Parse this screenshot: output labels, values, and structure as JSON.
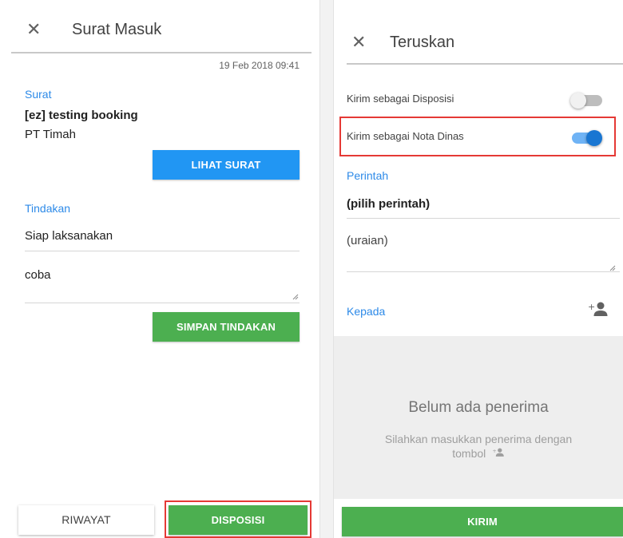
{
  "left": {
    "title": "Surat Masuk",
    "close_glyph": "✕",
    "date": "19 Feb 2018 09:41",
    "surat_label": "Surat",
    "surat_subject": "[ez] testing booking",
    "surat_org": "PT Timah",
    "lihat_button": "LIHAT SURAT",
    "tindakan_label": "Tindakan",
    "tindakan_value": "Siap laksanakan",
    "note_value": "coba",
    "simpan_button": "SIMPAN TINDAKAN",
    "riwayat_button": "RIWAYAT",
    "disposisi_button": "DISPOSISI"
  },
  "right": {
    "title": "Teruskan",
    "close_glyph": "✕",
    "toggle_disposisi_label": "Kirim sebagai Disposisi",
    "toggle_disposisi_on": false,
    "toggle_nota_label": "Kirim sebagai Nota Dinas",
    "toggle_nota_on": true,
    "perintah_label": "Perintah",
    "perintah_value": "(pilih perintah)",
    "uraian_placeholder": "(uraian)",
    "kepada_label": "Kepada",
    "empty_title": "Belum ada penerima",
    "empty_sub_line1": "Silahkan masukkan penerima dengan",
    "empty_sub_line2": "tombol",
    "kirim_button": "KIRIM"
  },
  "colors": {
    "accent_blue": "#2196f3",
    "accent_green": "#4caf50",
    "highlight_red": "#e53935"
  },
  "icons": [
    "close-icon",
    "add-person-icon",
    "resize-handle-icon"
  ]
}
